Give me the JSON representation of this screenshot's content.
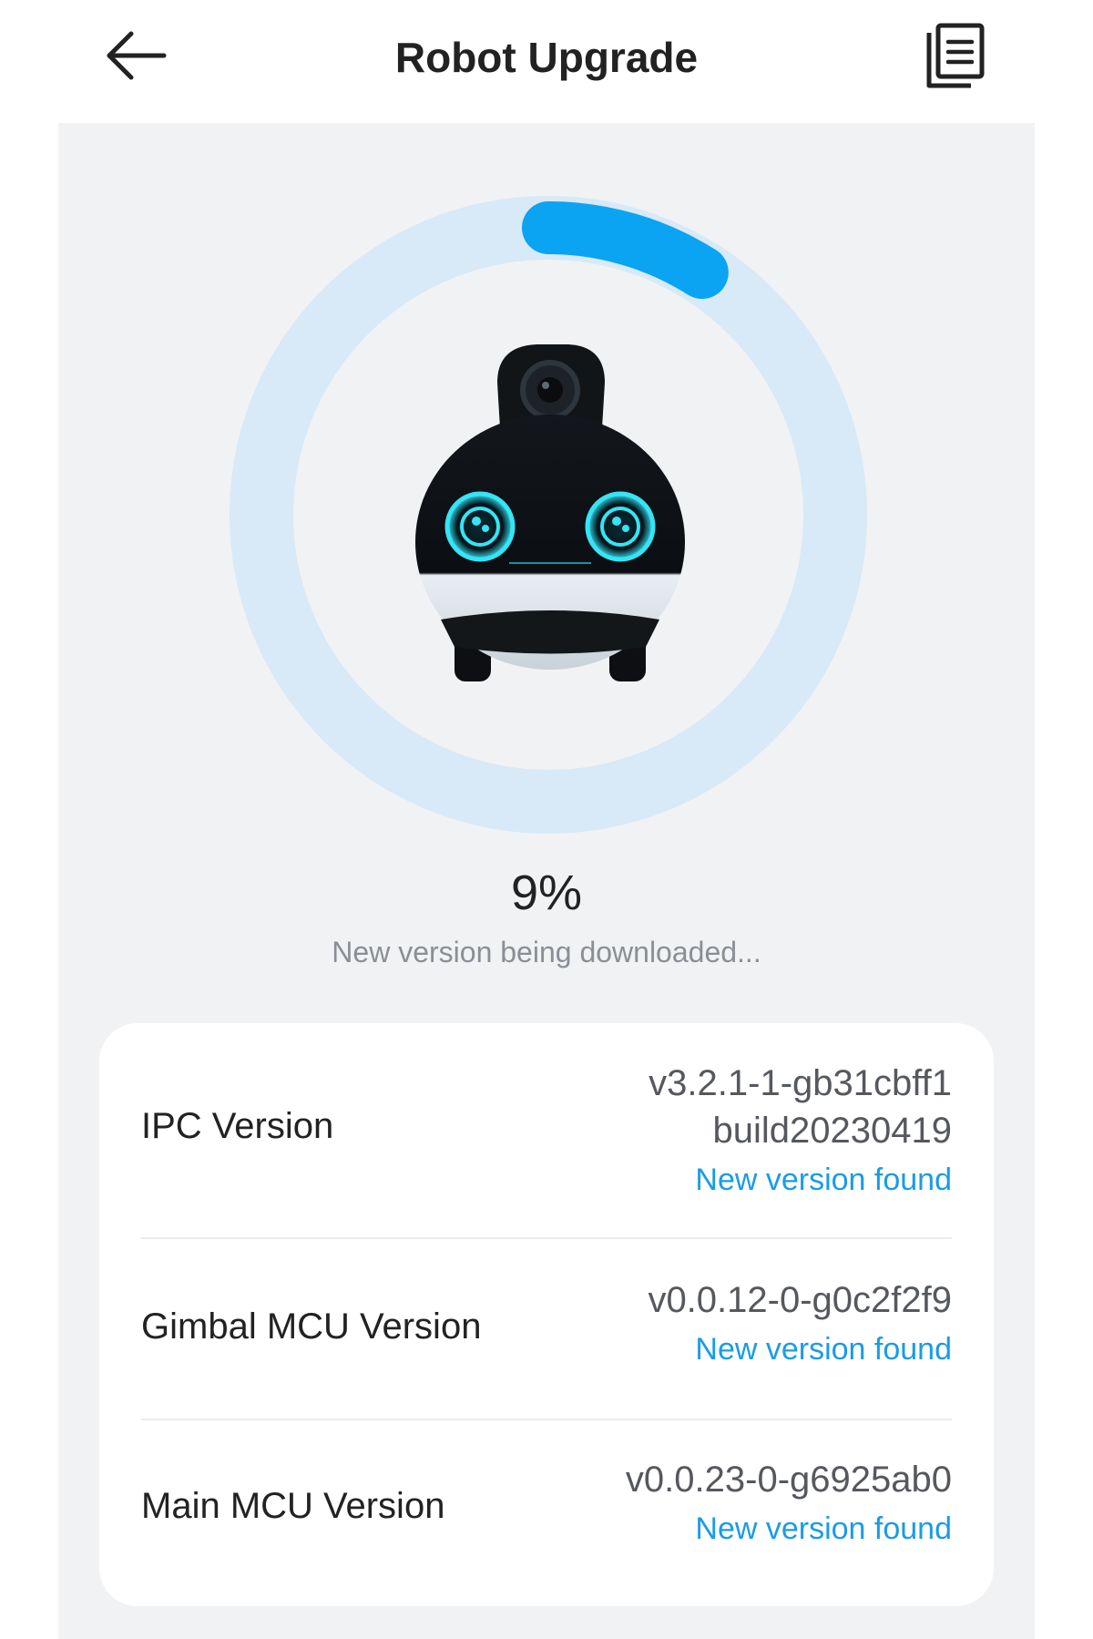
{
  "header": {
    "title": "Robot Upgrade",
    "back_icon": "arrow-left-icon",
    "log_icon": "document-list-icon"
  },
  "progress": {
    "value": 9,
    "percent_text": "9%",
    "status_text": "New version being downloaded...",
    "track_color": "#d8e9f7",
    "fill_color": "#0ba4f2"
  },
  "versions": [
    {
      "label": "IPC Version",
      "value": "v3.2.1-1-gb31cbff1\nbuild20230419",
      "action": "New version found"
    },
    {
      "label": "Gimbal MCU Version",
      "value": "v0.0.12-0-g0c2f2f9",
      "action": "New version found"
    },
    {
      "label": "Main MCU Version",
      "value": "v0.0.23-0-g6925ab0",
      "action": "New version found"
    }
  ],
  "colors": {
    "accent": "#1a9be8",
    "panel_background": "#f1f2f4"
  }
}
